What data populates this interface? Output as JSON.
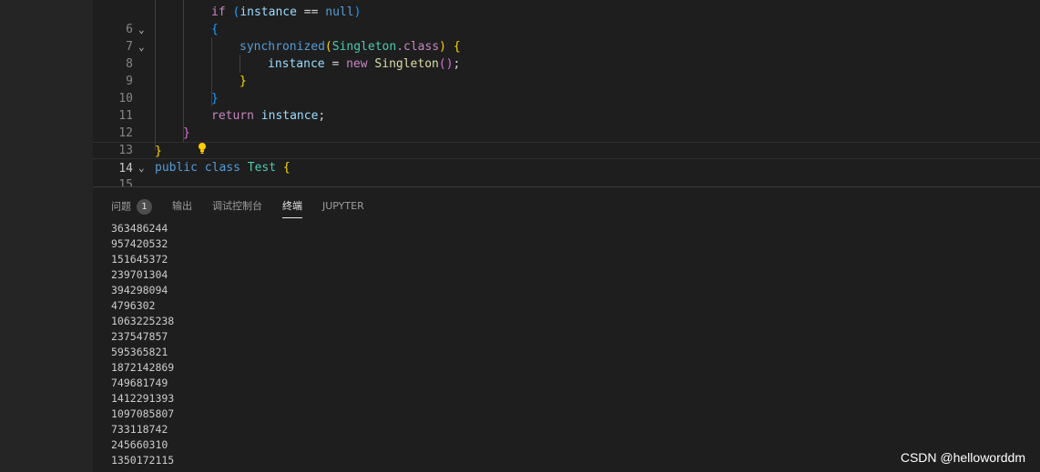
{
  "editor": {
    "active_line": "14",
    "lines": [
      {
        "no": "6",
        "fold": "",
        "bulb": false
      },
      {
        "no": "7",
        "fold": "⌄",
        "bulb": false
      },
      {
        "no": "8",
        "fold": "⌄",
        "bulb": false
      },
      {
        "no": "9",
        "fold": "",
        "bulb": false
      },
      {
        "no": "10",
        "fold": "",
        "bulb": false
      },
      {
        "no": "11",
        "fold": "",
        "bulb": false
      },
      {
        "no": "12",
        "fold": "",
        "bulb": false
      },
      {
        "no": "13",
        "fold": "",
        "bulb": true
      },
      {
        "no": "14",
        "fold": "",
        "bulb": false
      },
      {
        "no": "15",
        "fold": "⌄",
        "bulb": false
      }
    ],
    "tokens": {
      "if_kw": "if",
      "instance": "instance",
      "eq": "==",
      "null_kw": "null",
      "synchronized": "synchronized",
      "singleton": "Singleton",
      "dot_class": ".class",
      "new_kw": "new",
      "assign": "=",
      "return_kw": "return",
      "public_kw": "public",
      "class_kw": "class",
      "test": "Test",
      "open_paren": "(",
      "close_paren": ")",
      "open_brace": "{",
      "close_brace": "}",
      "semicolon": ";",
      "call_parens": "()"
    }
  },
  "panel": {
    "tabs": [
      {
        "label": "问题",
        "badge": "1"
      },
      {
        "label": "输出"
      },
      {
        "label": "调试控制台"
      },
      {
        "label": "终端"
      },
      {
        "label": "JUPYTER"
      }
    ],
    "active_tab": "终端",
    "terminal_output": [
      "363486244",
      "957420532",
      "151645372",
      "239701304",
      "394298094",
      "4796302",
      "1063225238",
      "237547857",
      "595365821",
      "1872142869",
      "749681749",
      "1412291393",
      "1097085807",
      "733118742",
      "245660310",
      "1350172115"
    ]
  },
  "watermark": "CSDN @helloworddm",
  "colors": {
    "background": "#1e1e1e",
    "keyword_control": "#c586c0",
    "keyword": "#569cd6",
    "variable": "#9cdcfe",
    "type": "#4ec9b0",
    "function": "#dcdcaa",
    "bracket_gold": "#ffd700",
    "bracket_orchid": "#da70d6",
    "bracket_blue": "#179fff"
  }
}
